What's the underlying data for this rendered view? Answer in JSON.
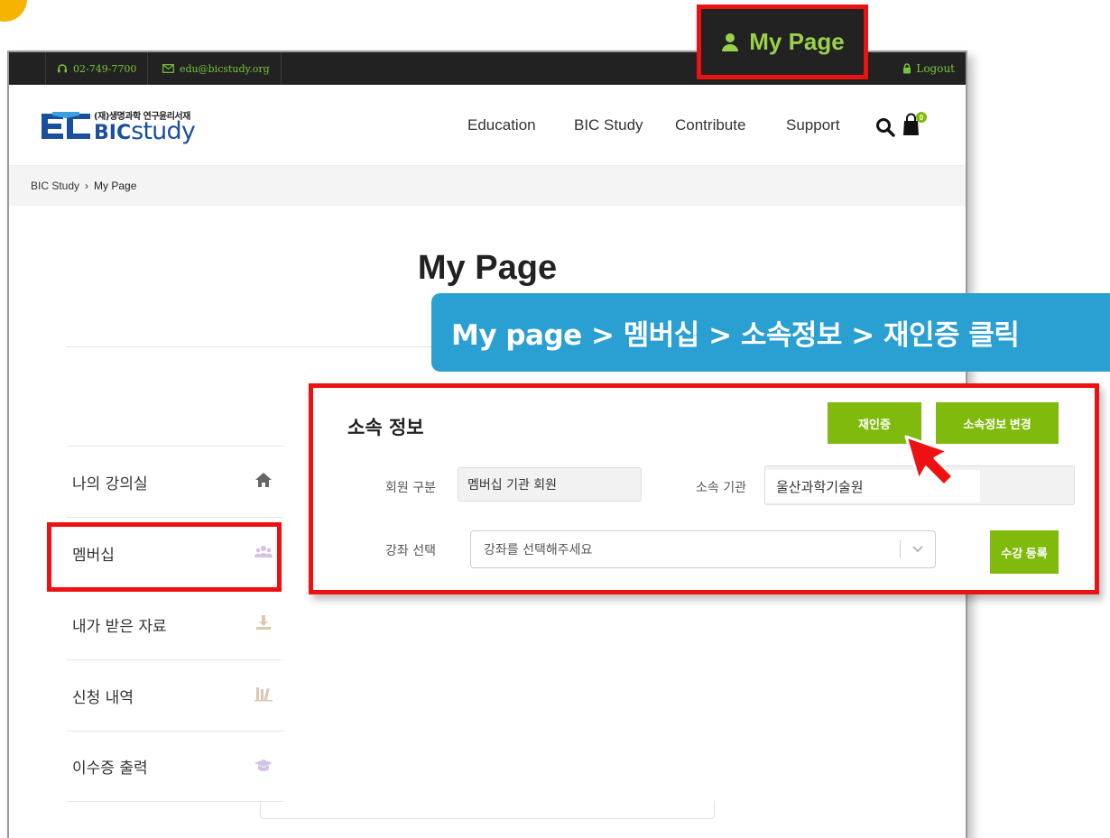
{
  "topbar": {
    "phone": "02-749-7700",
    "email": "edu@bicstudy.org",
    "logout": "Logout",
    "icons": {
      "phone": "headset-icon",
      "email": "envelope-icon",
      "logout": "lock-icon"
    }
  },
  "logo": {
    "subtitle": "(재)생명과학 연구윤리서재",
    "brand_bold": "BIC",
    "brand_light": "study"
  },
  "nav": {
    "items": [
      "Education",
      "BIC Study",
      "Contribute",
      "Support"
    ],
    "cart_count": "0"
  },
  "breadcrumb": {
    "parent": "BIC Study",
    "separator": "›",
    "current": "My Page"
  },
  "page": {
    "title": "My Page"
  },
  "sidebar": {
    "items": [
      {
        "label": "나의 강의실",
        "icon": "home-icon"
      },
      {
        "label": "멤버십",
        "icon": "group-icon"
      },
      {
        "label": "내가 받은 자료",
        "icon": "download-icon"
      },
      {
        "label": "신청 내역",
        "icon": "books-icon"
      },
      {
        "label": "이수증 출력",
        "icon": "graduation-cap-icon"
      }
    ]
  },
  "callout": {
    "label": "My Page",
    "icon": "user-icon"
  },
  "banner": {
    "text": "My page > 멤버십  > 소속정보 > 재인증 클릭"
  },
  "affiliation": {
    "title": "소속 정보",
    "reauth_button": "재인증",
    "change_button": "소속정보 변경",
    "member_type_label": "회원 구분",
    "member_type_value": "멤버십 기관 회원",
    "org_label": "소속 기관",
    "org_value": "울산과학기술원",
    "course_label": "강좌 선택",
    "course_placeholder": "강좌를 선택해주세요",
    "enroll_button": "수강 등록"
  },
  "colors": {
    "accent_green": "#7fba0c",
    "callout_green": "#9ad14b",
    "highlight_red": "#ee1111",
    "banner_blue": "#2a9fd2",
    "topbar_dark": "#222222",
    "brand_blue": "#1a4f9c"
  }
}
